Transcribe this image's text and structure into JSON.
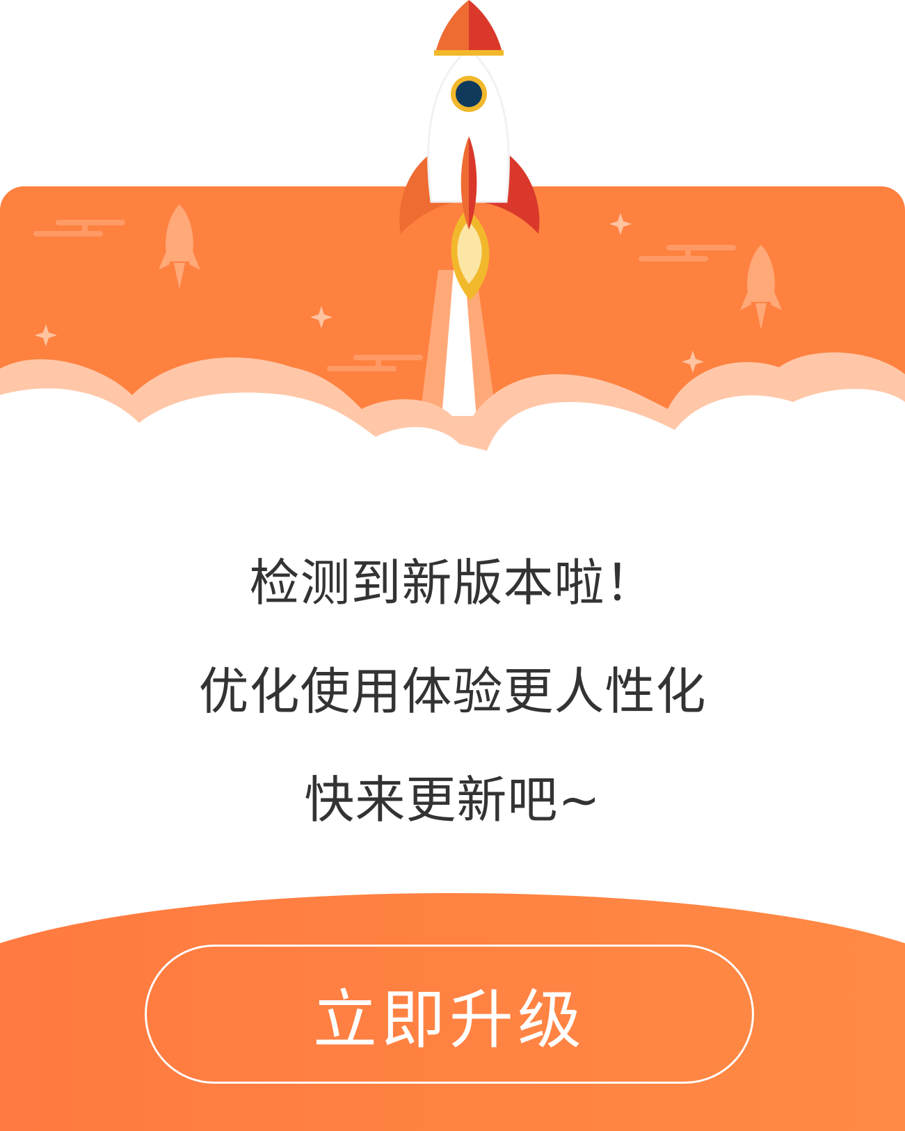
{
  "dialog": {
    "headline": "检测到新版本啦！",
    "subtitle": "优化使用体验更人性化",
    "call_to_action": "快来更新吧~",
    "button_label": "立即升级"
  },
  "icons": {
    "main": "rocket-icon",
    "decor": [
      "small-rocket-icon",
      "sparkle-icon",
      "cloud-icon"
    ]
  },
  "colors": {
    "accent": "#fe8140",
    "rocket_red": "#d9382b",
    "rocket_orange": "#ee6b32",
    "window": "#0f3a5c",
    "flame": "#f2b82b",
    "text": "#333333"
  }
}
